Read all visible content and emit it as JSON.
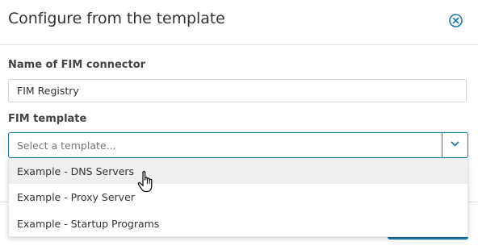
{
  "dialog": {
    "title": "Configure from the template",
    "close_icon": "close-circle-icon"
  },
  "form": {
    "name_label": "Name of FIM connector",
    "name_value": "FIM Registry",
    "template_label": "FIM template",
    "template_placeholder": "Select a template...",
    "template_options": [
      "Example - DNS Servers",
      "Example - Proxy Server",
      "Example - Startup Programs"
    ],
    "hovered_option_index": 0
  },
  "colors": {
    "accent": "#1a7da8",
    "hover_bg": "#efefef",
    "border": "#cfd4d8"
  },
  "icons": {
    "dropdown": "chevron-down-icon",
    "pointer": "hand-pointer-icon"
  }
}
